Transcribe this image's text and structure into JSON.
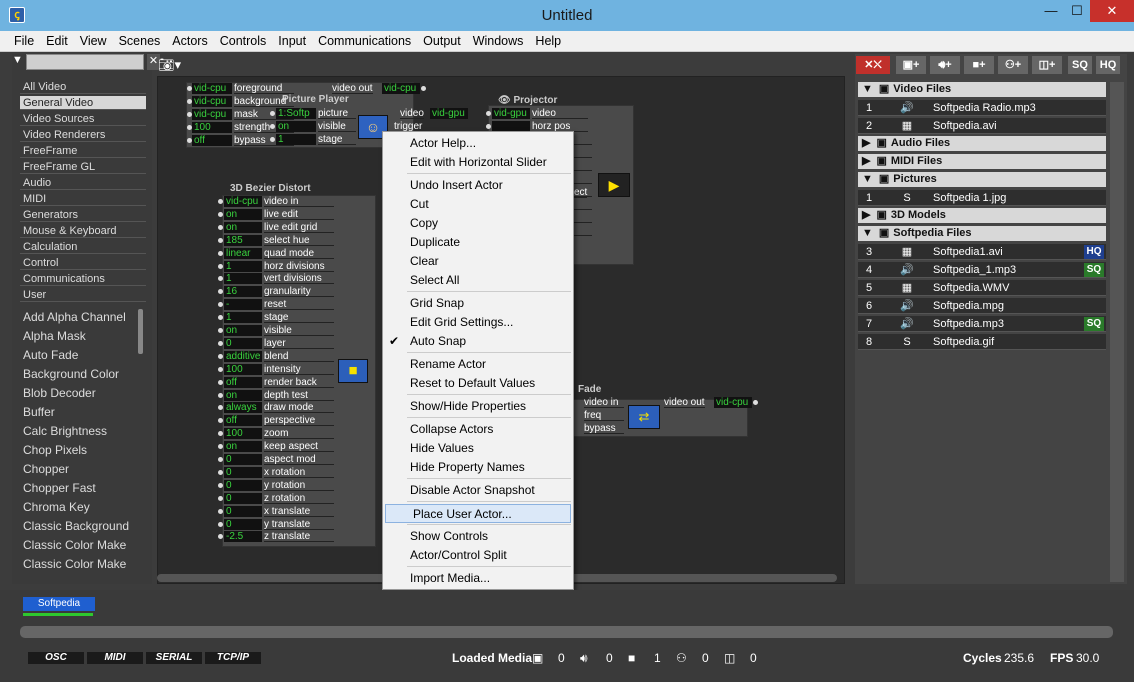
{
  "window": {
    "title": "Untitled",
    "min": "—",
    "max": "☐",
    "close": "✕"
  },
  "menu": [
    "File",
    "Edit",
    "View",
    "Scenes",
    "Actors",
    "Controls",
    "Input",
    "Communications",
    "Output",
    "Windows",
    "Help"
  ],
  "categories": [
    "All Video",
    "General Video",
    "Video Sources",
    "Video Renderers",
    "FreeFrame",
    "FreeFrame GL",
    "Audio",
    "MIDI",
    "Generators",
    "Mouse & Keyboard",
    "Calculation",
    "Control",
    "Communications",
    "User"
  ],
  "actors_list": [
    "Add Alpha Channel",
    "Alpha Mask",
    "Auto Fade",
    "Background Color",
    "Blob Decoder",
    "Buffer",
    "Calc Brightness",
    "Chop Pixels",
    "Chopper",
    "Chopper Fast",
    "Chroma Key",
    "Classic Background",
    "Classic Color Make",
    "Classic Color Make"
  ],
  "picture_player": {
    "title": "Picture Player",
    "inputs": [
      [
        "vid-cpu",
        "foreground"
      ],
      [
        "vid-cpu",
        "background"
      ],
      [
        "vid-cpu",
        "mask"
      ],
      [
        "100",
        "strength"
      ],
      [
        "off",
        "bypass"
      ]
    ],
    "props": [
      [
        "1:Softp",
        "picture"
      ],
      [
        "on",
        "visible"
      ],
      [
        "1",
        "stage"
      ]
    ],
    "out_label": "video out",
    "out_val": "vid-cpu",
    "out2_label": "video",
    "out2_val": "vid-gpu",
    "trigger": "trigger"
  },
  "projector": {
    "title": "Projector",
    "inputs": [
      [
        "vid-gpu",
        "video"
      ],
      [
        "",
        "horz pos"
      ]
    ],
    "ect": "ect"
  },
  "bezier": {
    "title": "3D Bezier Distort",
    "props": [
      [
        "vid-cpu",
        "video in"
      ],
      [
        "on",
        "live edit"
      ],
      [
        "on",
        "live edit grid"
      ],
      [
        "185",
        "select hue"
      ],
      [
        "linear",
        "quad mode"
      ],
      [
        "1",
        "horz divisions"
      ],
      [
        "1",
        "vert divisions"
      ],
      [
        "16",
        "granularity"
      ],
      [
        "-",
        "reset"
      ],
      [
        "1",
        "stage"
      ],
      [
        "on",
        "visible"
      ],
      [
        "0",
        "layer"
      ],
      [
        "additive",
        "blend"
      ],
      [
        "100",
        "intensity"
      ],
      [
        "off",
        "render back"
      ],
      [
        "on",
        "depth test"
      ],
      [
        "always",
        "draw mode"
      ],
      [
        "off",
        "perspective"
      ],
      [
        "100",
        "zoom"
      ],
      [
        "on",
        "keep aspect"
      ],
      [
        "0",
        "aspect mod"
      ],
      [
        "0",
        "x rotation"
      ],
      [
        "0",
        "y rotation"
      ],
      [
        "0",
        "z rotation"
      ],
      [
        "0",
        "x translate"
      ],
      [
        "0",
        "y translate"
      ],
      [
        "-2.5",
        "z translate"
      ]
    ]
  },
  "fade": {
    "title": "Fade",
    "props": [
      "video in",
      "freq",
      "bypass"
    ],
    "out_label": "video out",
    "out_val": "vid-cpu"
  },
  "context_menu": [
    {
      "label": "Actor Help..."
    },
    {
      "label": "Edit with Horizontal Slider"
    },
    {
      "sep": true
    },
    {
      "label": "Undo Insert Actor"
    },
    {
      "label": "Cut"
    },
    {
      "label": "Copy"
    },
    {
      "label": "Duplicate"
    },
    {
      "label": "Clear"
    },
    {
      "label": "Select All"
    },
    {
      "sep": true
    },
    {
      "label": "Grid Snap"
    },
    {
      "label": "Edit Grid Settings..."
    },
    {
      "label": "Auto Snap",
      "check": "✔"
    },
    {
      "sep": true
    },
    {
      "label": "Rename Actor"
    },
    {
      "label": "Reset to Default Values"
    },
    {
      "sep": true
    },
    {
      "label": "Show/Hide Properties"
    },
    {
      "sep": true
    },
    {
      "label": "Collapse Actors"
    },
    {
      "label": "Hide Values"
    },
    {
      "label": "Hide Property Names"
    },
    {
      "sep": true
    },
    {
      "label": "Disable Actor Snapshot"
    },
    {
      "sep": true
    },
    {
      "label": "Place User Actor...",
      "hl": true
    },
    {
      "sep": true
    },
    {
      "label": "Show Controls"
    },
    {
      "label": "Actor/Control Split"
    },
    {
      "sep": true
    },
    {
      "label": "Import Media..."
    }
  ],
  "media_toolbar": {
    "sq": "SQ",
    "hq": "HQ",
    "plus": "+"
  },
  "media": {
    "groups": [
      {
        "name": "Video Files",
        "open": true,
        "files": [
          {
            "n": "1",
            "icon": "🔊",
            "name": "Softpedia Radio.mp3"
          },
          {
            "n": "2",
            "icon": "▦",
            "name": "Softpedia.avi"
          }
        ]
      },
      {
        "name": "Audio Files",
        "open": false,
        "files": []
      },
      {
        "name": "MIDI Files",
        "open": false,
        "files": []
      },
      {
        "name": "Pictures",
        "open": true,
        "files": [
          {
            "n": "1",
            "icon": "S",
            "name": "Softpedia 1.jpg"
          }
        ]
      },
      {
        "name": "3D Models",
        "open": false,
        "files": []
      },
      {
        "name": "Softpedia Files",
        "open": true,
        "files": [
          {
            "n": "3",
            "icon": "▦",
            "name": "Softpedia1.avi",
            "badge": "HQ"
          },
          {
            "n": "4",
            "icon": "🔊",
            "name": "Softpedia_1.mp3",
            "badge": "SQ"
          },
          {
            "n": "5",
            "icon": "▦",
            "name": "Softpedia.WMV"
          },
          {
            "n": "6",
            "icon": "🔊",
            "name": "Softpedia.mpg"
          },
          {
            "n": "7",
            "icon": "🔊",
            "name": "Softpedia.mp3",
            "badge": "SQ"
          },
          {
            "n": "8",
            "icon": "S",
            "name": "Softpedia.gif"
          }
        ]
      }
    ]
  },
  "scene": {
    "name": "Softpedia"
  },
  "status": {
    "protocols": [
      "OSC",
      "MIDI",
      "SERIAL",
      "TCP/IP"
    ],
    "loaded_media_label": "Loaded Media",
    "counts": [
      "0",
      "0",
      "1",
      "0",
      "0"
    ],
    "cycles_label": "Cycles",
    "cycles": "235.6",
    "fps_label": "FPS",
    "fps": "30.0"
  },
  "colors": {
    "accent": "#1f5fd0",
    "value_green": "#39d23e",
    "highlight": "#dbe8f8"
  }
}
